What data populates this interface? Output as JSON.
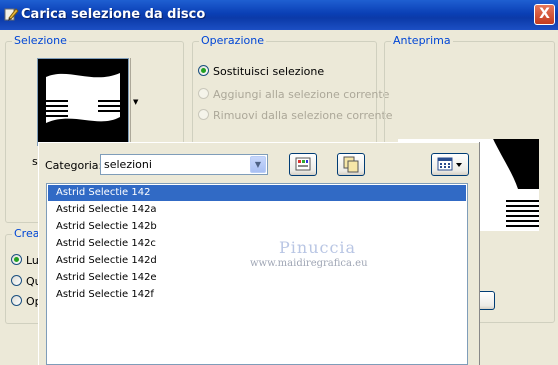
{
  "window": {
    "title": "Carica selezione da disco",
    "close_glyph": "X"
  },
  "selezione": {
    "legend": "Selezione",
    "partial_label": "s"
  },
  "operazione": {
    "legend": "Operazione",
    "options": [
      {
        "label": "Sostituisci selezione",
        "checked": true,
        "enabled": true
      },
      {
        "label": "Aggiungi alla selezione corrente",
        "checked": false,
        "enabled": false
      },
      {
        "label": "Rimuovi dalla selezione corrente",
        "checked": false,
        "enabled": false
      }
    ]
  },
  "anteprima": {
    "legend": "Anteprima"
  },
  "crea": {
    "legend_partial": "Crea",
    "options_partial": [
      {
        "label": "Lu",
        "checked": true
      },
      {
        "label": "Qu",
        "checked": false
      },
      {
        "label": "Op",
        "checked": false
      }
    ]
  },
  "popup": {
    "category_label": "Categoria:",
    "category_value": "selezioni",
    "toolbar_icons": [
      "edit-paths-icon",
      "copy-icon",
      "view-options-icon"
    ],
    "items": [
      "Astrid Selectie 142",
      "Astrid Selectie 142a",
      "Astrid Selectie 142b",
      "Astrid Selectie 142c",
      "Astrid Selectie 142d",
      "Astrid Selectie 142e",
      "Astrid Selectie 142f"
    ],
    "selected_index": 0,
    "watermark_title": "Pinuccia",
    "watermark_url": "www.maidiregrafica.eu"
  },
  "colors": {
    "selection": "#316ac5",
    "titlebar": "#0a3fb5",
    "legend": "#0046d5"
  }
}
